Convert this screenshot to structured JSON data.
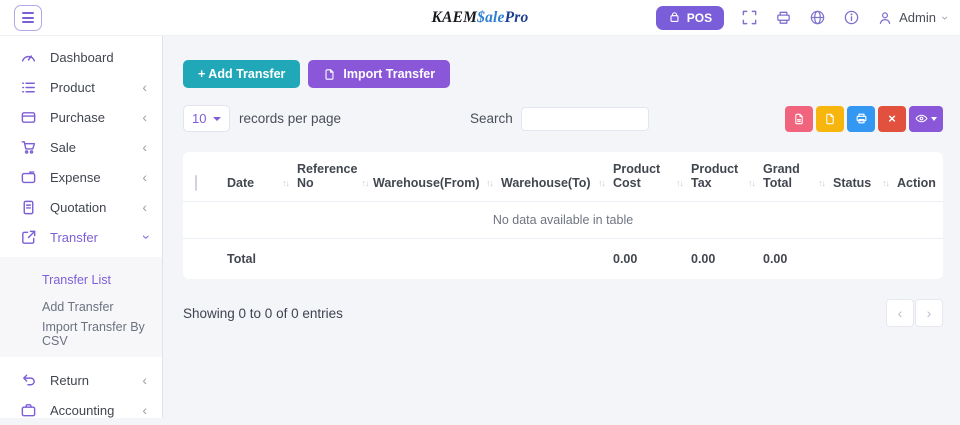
{
  "topbar": {
    "logo": {
      "kaem": "KAEM",
      "sale": "$ale",
      "pro": "Pro"
    },
    "pos_label": "POS",
    "admin_label": "Admin"
  },
  "icons": {
    "chevron_glyph": "‹",
    "close_glyph": "×",
    "plus_glyph": "+"
  },
  "sidebar": {
    "items": [
      {
        "label": "Dashboard",
        "chevron": ""
      },
      {
        "label": "Product",
        "chevron": "‹"
      },
      {
        "label": "Purchase",
        "chevron": "‹"
      },
      {
        "label": "Sale",
        "chevron": "‹"
      },
      {
        "label": "Expense",
        "chevron": "‹"
      },
      {
        "label": "Quotation",
        "chevron": "‹"
      },
      {
        "label": "Transfer",
        "chevron": "‹"
      },
      {
        "label": "Return",
        "chevron": "‹"
      },
      {
        "label": "Accounting",
        "chevron": "‹"
      }
    ],
    "transfer_submenu": [
      {
        "label": "Transfer List",
        "active": true
      },
      {
        "label": "Add Transfer",
        "active": false
      },
      {
        "label": "Import Transfer By CSV",
        "active": false
      }
    ]
  },
  "toolbar": {
    "add_transfer_label": "+ Add Transfer",
    "import_transfer_label": "Import Transfer"
  },
  "controls": {
    "records_value": "10",
    "records_label": "records per page",
    "search_label": "Search",
    "search_value": ""
  },
  "table": {
    "sort_glyph": "↑↓",
    "columns": [
      {
        "label": "Date",
        "sortable": true
      },
      {
        "label": "Reference No",
        "sortable": true
      },
      {
        "label": "Warehouse(From)",
        "sortable": true
      },
      {
        "label": "Warehouse(To)",
        "sortable": true
      },
      {
        "label": "Product Cost",
        "sortable": true
      },
      {
        "label": "Product Tax",
        "sortable": true
      },
      {
        "label": "Grand Total",
        "sortable": true
      },
      {
        "label": "Status",
        "sortable": true
      },
      {
        "label": "Action",
        "sortable": false
      }
    ],
    "empty_message": "No data available in table",
    "total": {
      "label": "Total",
      "product_cost": "0.00",
      "product_tax": "0.00",
      "grand_total": "0.00"
    }
  },
  "pagination": {
    "showing_text": "Showing 0 to 0 of 0 entries",
    "prev_glyph": "‹",
    "next_glyph": "›"
  },
  "colors": {
    "accent_purple": "#7c5fd6",
    "pos_purple": "#7a5ed9",
    "teal": "#21a8b8",
    "import_purple": "#8957d8",
    "pdf_pink": "#f1647e",
    "excel_amber": "#f6b60e",
    "print_blue": "#3498f3",
    "close_red": "#e2503e",
    "logo_blue": "#2f7fd3",
    "logo_navy": "#1b3f8f"
  }
}
